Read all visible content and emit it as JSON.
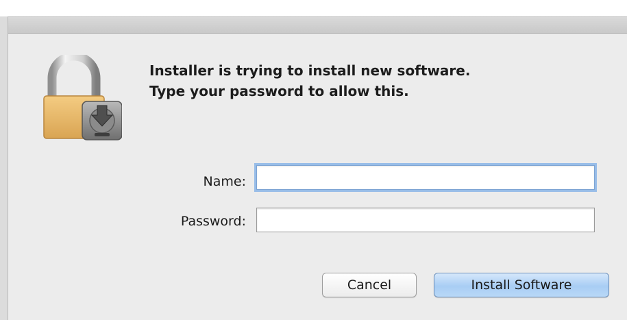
{
  "dialog": {
    "message_line1": "Installer is trying to install new software.",
    "message_line2": "Type your password to allow this.",
    "icon": "lock-installer-icon"
  },
  "form": {
    "name_label": "Name:",
    "name_value": "",
    "password_label": "Password:",
    "password_value": ""
  },
  "buttons": {
    "cancel_label": "Cancel",
    "install_label": "Install Software"
  },
  "colors": {
    "accent": "#a8cdf4",
    "focus_ring": "#98bde8",
    "lock_gold": "#e7b869"
  }
}
